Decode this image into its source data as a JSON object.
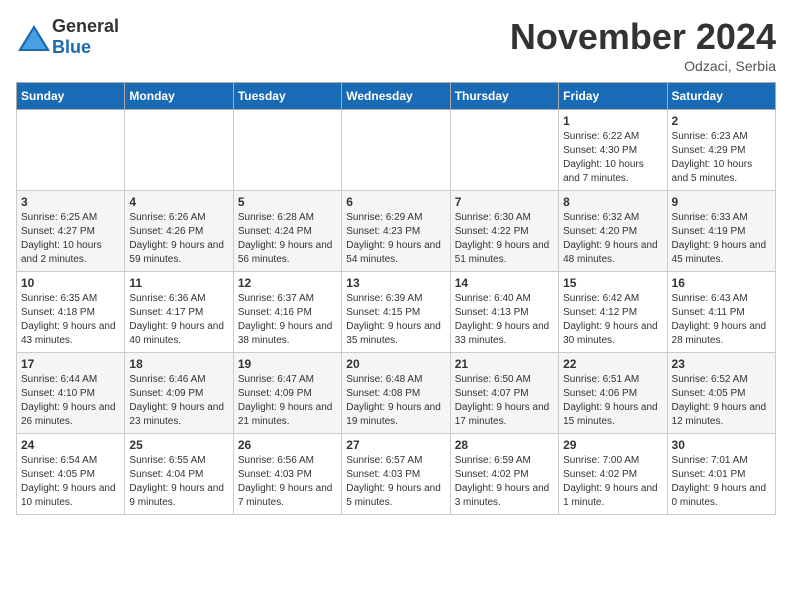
{
  "logo": {
    "general": "General",
    "blue": "Blue"
  },
  "header": {
    "month": "November 2024",
    "location": "Odzaci, Serbia"
  },
  "weekdays": [
    "Sunday",
    "Monday",
    "Tuesday",
    "Wednesday",
    "Thursday",
    "Friday",
    "Saturday"
  ],
  "weeks": [
    [
      {
        "day": "",
        "info": ""
      },
      {
        "day": "",
        "info": ""
      },
      {
        "day": "",
        "info": ""
      },
      {
        "day": "",
        "info": ""
      },
      {
        "day": "",
        "info": ""
      },
      {
        "day": "1",
        "info": "Sunrise: 6:22 AM\nSunset: 4:30 PM\nDaylight: 10 hours and 7 minutes."
      },
      {
        "day": "2",
        "info": "Sunrise: 6:23 AM\nSunset: 4:29 PM\nDaylight: 10 hours and 5 minutes."
      }
    ],
    [
      {
        "day": "3",
        "info": "Sunrise: 6:25 AM\nSunset: 4:27 PM\nDaylight: 10 hours and 2 minutes."
      },
      {
        "day": "4",
        "info": "Sunrise: 6:26 AM\nSunset: 4:26 PM\nDaylight: 9 hours and 59 minutes."
      },
      {
        "day": "5",
        "info": "Sunrise: 6:28 AM\nSunset: 4:24 PM\nDaylight: 9 hours and 56 minutes."
      },
      {
        "day": "6",
        "info": "Sunrise: 6:29 AM\nSunset: 4:23 PM\nDaylight: 9 hours and 54 minutes."
      },
      {
        "day": "7",
        "info": "Sunrise: 6:30 AM\nSunset: 4:22 PM\nDaylight: 9 hours and 51 minutes."
      },
      {
        "day": "8",
        "info": "Sunrise: 6:32 AM\nSunset: 4:20 PM\nDaylight: 9 hours and 48 minutes."
      },
      {
        "day": "9",
        "info": "Sunrise: 6:33 AM\nSunset: 4:19 PM\nDaylight: 9 hours and 45 minutes."
      }
    ],
    [
      {
        "day": "10",
        "info": "Sunrise: 6:35 AM\nSunset: 4:18 PM\nDaylight: 9 hours and 43 minutes."
      },
      {
        "day": "11",
        "info": "Sunrise: 6:36 AM\nSunset: 4:17 PM\nDaylight: 9 hours and 40 minutes."
      },
      {
        "day": "12",
        "info": "Sunrise: 6:37 AM\nSunset: 4:16 PM\nDaylight: 9 hours and 38 minutes."
      },
      {
        "day": "13",
        "info": "Sunrise: 6:39 AM\nSunset: 4:15 PM\nDaylight: 9 hours and 35 minutes."
      },
      {
        "day": "14",
        "info": "Sunrise: 6:40 AM\nSunset: 4:13 PM\nDaylight: 9 hours and 33 minutes."
      },
      {
        "day": "15",
        "info": "Sunrise: 6:42 AM\nSunset: 4:12 PM\nDaylight: 9 hours and 30 minutes."
      },
      {
        "day": "16",
        "info": "Sunrise: 6:43 AM\nSunset: 4:11 PM\nDaylight: 9 hours and 28 minutes."
      }
    ],
    [
      {
        "day": "17",
        "info": "Sunrise: 6:44 AM\nSunset: 4:10 PM\nDaylight: 9 hours and 26 minutes."
      },
      {
        "day": "18",
        "info": "Sunrise: 6:46 AM\nSunset: 4:09 PM\nDaylight: 9 hours and 23 minutes."
      },
      {
        "day": "19",
        "info": "Sunrise: 6:47 AM\nSunset: 4:09 PM\nDaylight: 9 hours and 21 minutes."
      },
      {
        "day": "20",
        "info": "Sunrise: 6:48 AM\nSunset: 4:08 PM\nDaylight: 9 hours and 19 minutes."
      },
      {
        "day": "21",
        "info": "Sunrise: 6:50 AM\nSunset: 4:07 PM\nDaylight: 9 hours and 17 minutes."
      },
      {
        "day": "22",
        "info": "Sunrise: 6:51 AM\nSunset: 4:06 PM\nDaylight: 9 hours and 15 minutes."
      },
      {
        "day": "23",
        "info": "Sunrise: 6:52 AM\nSunset: 4:05 PM\nDaylight: 9 hours and 12 minutes."
      }
    ],
    [
      {
        "day": "24",
        "info": "Sunrise: 6:54 AM\nSunset: 4:05 PM\nDaylight: 9 hours and 10 minutes."
      },
      {
        "day": "25",
        "info": "Sunrise: 6:55 AM\nSunset: 4:04 PM\nDaylight: 9 hours and 9 minutes."
      },
      {
        "day": "26",
        "info": "Sunrise: 6:56 AM\nSunset: 4:03 PM\nDaylight: 9 hours and 7 minutes."
      },
      {
        "day": "27",
        "info": "Sunrise: 6:57 AM\nSunset: 4:03 PM\nDaylight: 9 hours and 5 minutes."
      },
      {
        "day": "28",
        "info": "Sunrise: 6:59 AM\nSunset: 4:02 PM\nDaylight: 9 hours and 3 minutes."
      },
      {
        "day": "29",
        "info": "Sunrise: 7:00 AM\nSunset: 4:02 PM\nDaylight: 9 hours and 1 minute."
      },
      {
        "day": "30",
        "info": "Sunrise: 7:01 AM\nSunset: 4:01 PM\nDaylight: 9 hours and 0 minutes."
      }
    ]
  ]
}
